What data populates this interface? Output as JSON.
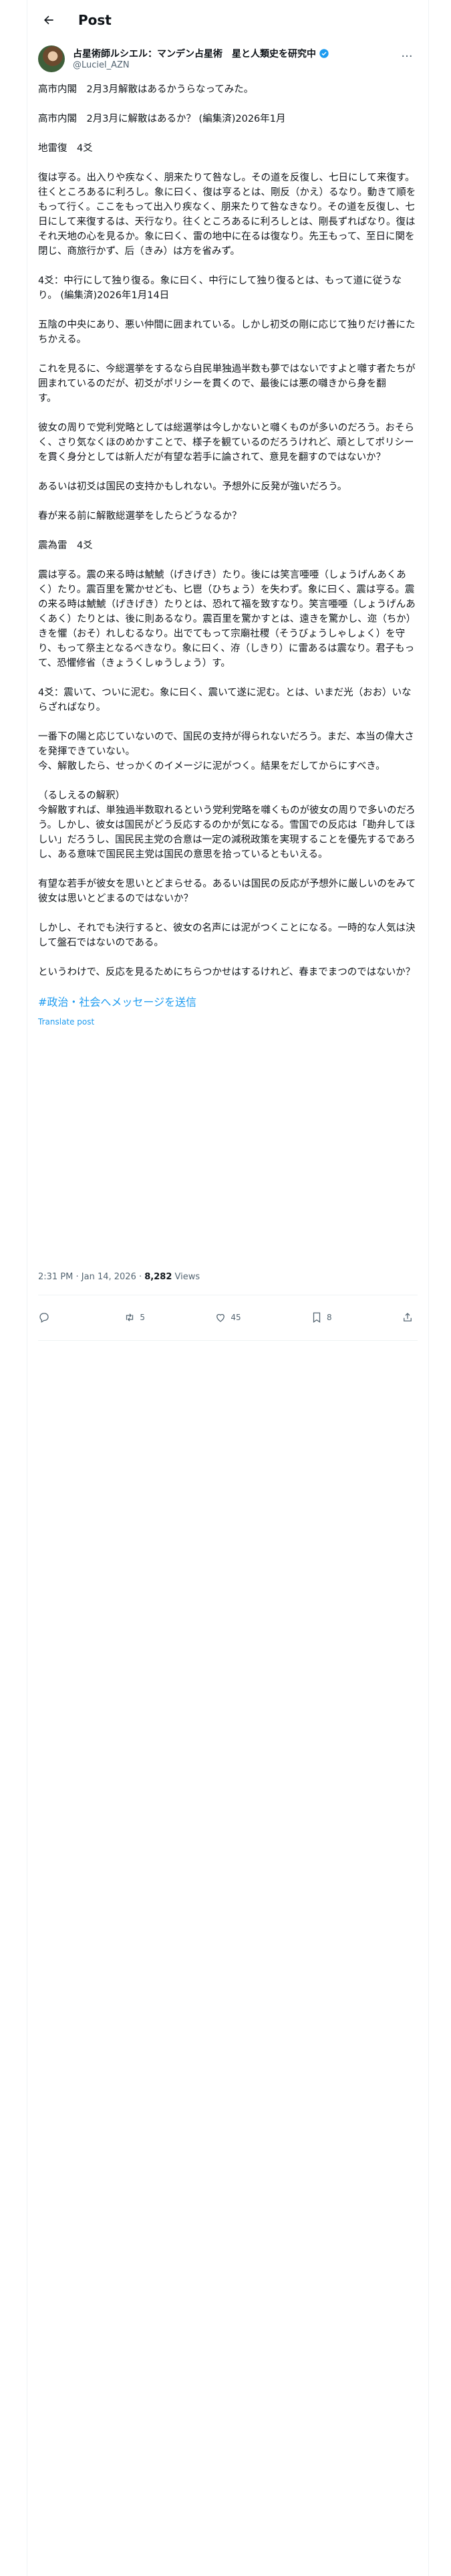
{
  "header": {
    "title": "Post"
  },
  "author": {
    "display_name": "占星術師ルシエル：マンデン占星術　星と人類史を研究中",
    "handle": "@Luciel_AZN"
  },
  "post": {
    "paragraphs": [
      "高市内閣　2月3月解散はあるかうらなってみた。",
      "高市内閣　2月3月に解散はあるか？ (編集済)2026年1月",
      "地雷復　4爻",
      "復は亨る。出入りや疾なく、朋来たりて咎なし。その道を反復し、七日にして来復す。往くところあるに利ろし。象に曰く、復は亨るとは、剛反（かえ）るなり。動きて順をもって行く。ここをもって出入り疾なく、朋来たりて咎なきなり。その道を反復し、七日にして来復するは、天行なり。往くところあるに利ろしとは、剛長ずればなり。復はそれ天地の心を見るか。象に曰く、雷の地中に在るは復なり。先王もって、至日に関を閉じ、商旅行かず、后（きみ）は方を省みず。",
      "4爻：中行にして独り復る。象に曰く、中行にして独り復るとは、もって道に従うなり。 (編集済)2026年1月14日",
      "五陰の中央にあり、悪い仲間に囲まれている。しかし初爻の剛に応じて独りだけ善にたちかえる。",
      "これを見るに、今総選挙をするなら自民単独過半数も夢ではないですよと囃す者たちが囲まれているのだが、初爻がポリシーを貫くので、最後には悪の囃きから身を翻\nす。",
      "彼女の周りで党利党略としては総選挙は今しかないと囃くものが多いのだろう。おそらく、さり気なくほのめかすことで、様子を観ているのだろうけれど、頑としてポリシーを貫く身分としては新人だが有望な若手に論されて、意見を翻すのではないか？",
      "あるいは初爻は国民の支持かもしれない。予想外に反発が強いだろう。",
      "春が来る前に解散総選挙をしたらどうなるか？",
      "震為雷　4爻",
      "震は亨る。震の来る時は鯱鯱（げきげき）たり。後には笑言唖唖（しょうげんあくあく）たり。震百里を驚かせども、匕鬯（ひちょう）を失わず。象に曰く、震は亨る。震の来る時は鯱鯱（げきげき）たりとは、恐れて福を致すなり。笑言唖唖（しょうげんあくあく）たりとは、後に則あるなり。震百里を驚かすとは、遠きを驚かし、迩（ちか）きを懼（おそ）れしむるなり。出でてもって宗廟社稷（そうびょうしゃしょく）を守り、もって祭主となるべきなり。象に曰く、洊（しきり）に雷あるは震なり。君子もって、恐懼修省（きょうくしゅうしょう）す。",
      "4爻：震いて、ついに泥む。象に曰く、震いて遂に泥む。とは、いまだ光（おお）いならざればなり。",
      "一番下の陽と応じていないので、国民の支持が得られないだろう。まだ、本当の偉大さを発揮できていない。\n今、解散したら、せっかくのイメージに泥がつく。結果をだしてからにすべき。",
      "（るしえるの解釈）\n今解散すれば、単独過半数取れるという党利党略を囃くものが彼女の周りで多いのだろう。しかし、彼女は国民がどう反応するのかが気になる。雪国での反応は「勘弁してほしい」だろうし、国民民主党の合意は一定の減税政策を実現することを優先するであろし、ある意味で国民民主党は国民の意思を拾っているともいえる。",
      "有望な若手が彼女を思いとどまらせる。あるいは国民の反応が予想外に厳しいのをみて彼女は思いとどまるのではないか？",
      "しかし、それでも決行すると、彼女の名声には泥がつくことになる。一時的な人気は決して盤石ではないのである。",
      "というわけで、反応を見るためにちらつかせはするけれど、春までまつのではないか？"
    ],
    "hashtag": "#政治・社会へメッセージを送信",
    "translate_label": "Translate post",
    "time": "2:31 PM · Jan 14, 2026",
    "separator": " · ",
    "views_count": "8,282",
    "views_label": " Views"
  },
  "actions": {
    "reply_count": "",
    "repost_count": "5",
    "like_count": "45",
    "bookmark_count": "8"
  },
  "colors": {
    "accent": "#1d9bf0",
    "muted": "#536471",
    "border": "#eff3f4"
  }
}
